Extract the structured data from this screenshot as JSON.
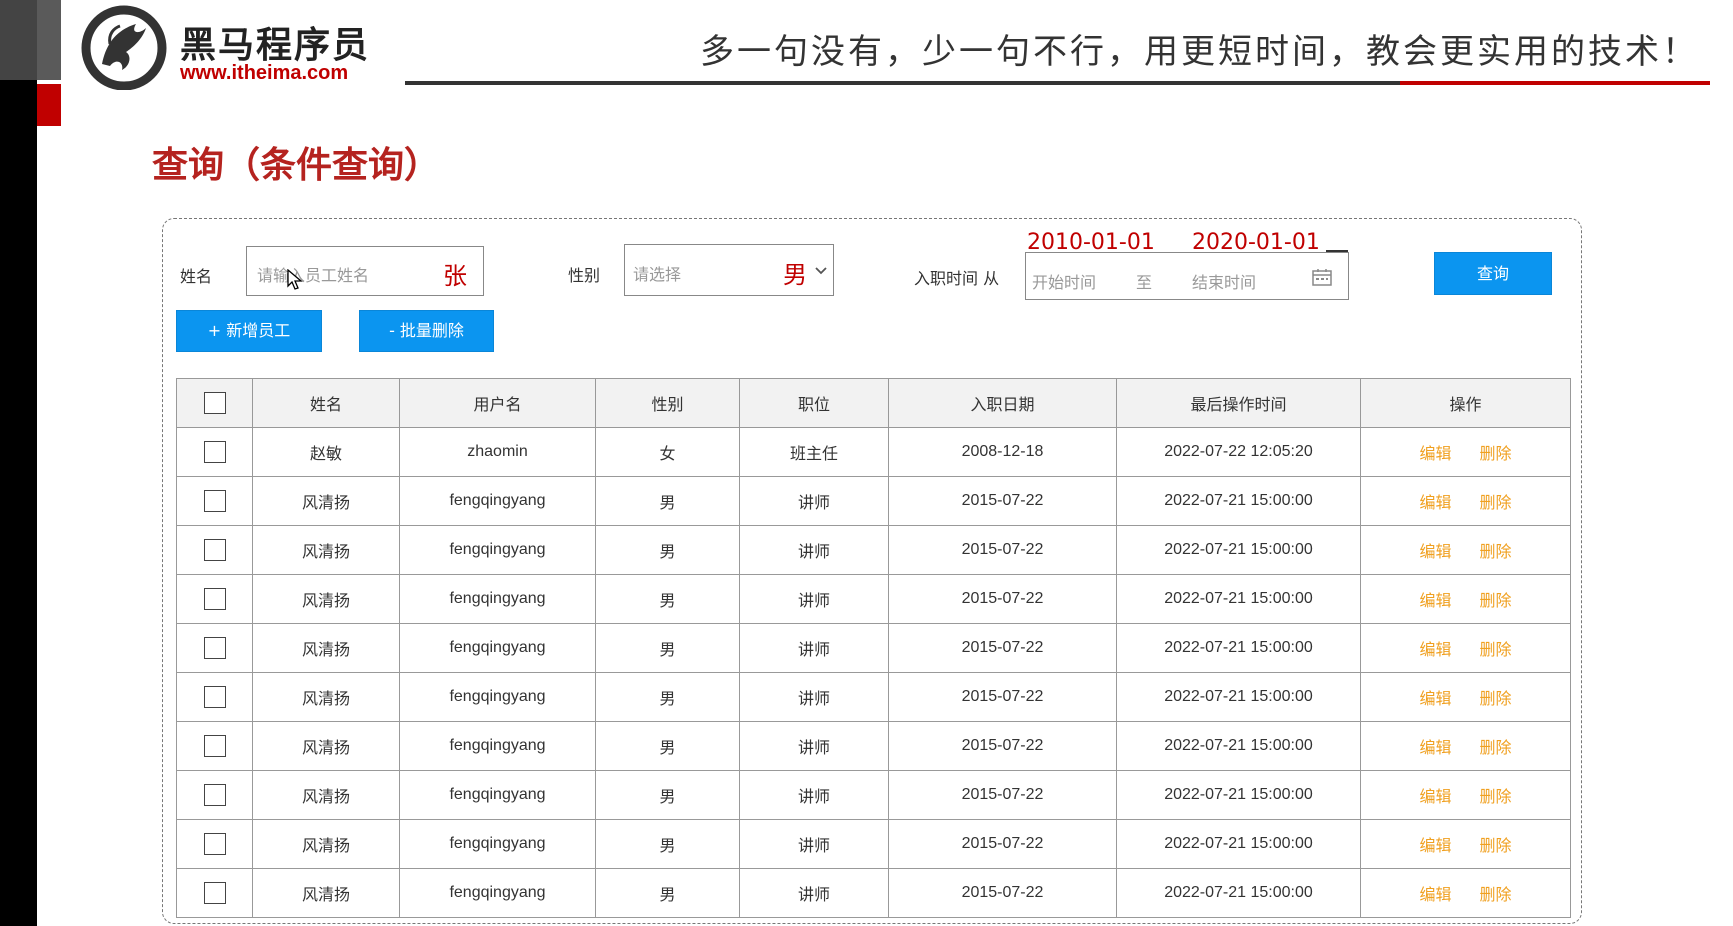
{
  "header": {
    "brand_name": "黑马程序员",
    "brand_url": "www.itheima.com",
    "slogan": "多一句没有，少一句不行，用更短时间，教会更实用的技术！"
  },
  "page_title": "查询（条件查询）",
  "filters": {
    "name_label": "姓名",
    "name_placeholder": "请输入员工姓名",
    "name_annotation": "张",
    "gender_label": "性别",
    "gender_placeholder": "请选择",
    "gender_annotation": "男",
    "date_label": "入职时间 从",
    "date_start_placeholder": "开始时间",
    "date_separator": "至",
    "date_end_placeholder": "结束时间",
    "date_start_annotation": "2010-01-01",
    "date_end_annotation": "2020-01-01",
    "query_button": "查询"
  },
  "toolbar": {
    "add_button": "+ 新增员工",
    "batch_delete_button": "- 批量删除"
  },
  "table": {
    "columns": [
      "姓名",
      "用户名",
      "性别",
      "职位",
      "入职日期",
      "最后操作时间",
      "操作"
    ],
    "actions": [
      "编辑",
      "删除"
    ],
    "rows": [
      [
        "赵敏",
        "zhaomin",
        "女",
        "班主任",
        "2008-12-18",
        "2022-07-22 12:05:20"
      ],
      [
        "风清扬",
        "fengqingyang",
        "男",
        "讲师",
        "2015-07-22",
        "2022-07-21 15:00:00"
      ],
      [
        "风清扬",
        "fengqingyang",
        "男",
        "讲师",
        "2015-07-22",
        "2022-07-21 15:00:00"
      ],
      [
        "风清扬",
        "fengqingyang",
        "男",
        "讲师",
        "2015-07-22",
        "2022-07-21 15:00:00"
      ],
      [
        "风清扬",
        "fengqingyang",
        "男",
        "讲师",
        "2015-07-22",
        "2022-07-21 15:00:00"
      ],
      [
        "风清扬",
        "fengqingyang",
        "男",
        "讲师",
        "2015-07-22",
        "2022-07-21 15:00:00"
      ],
      [
        "风清扬",
        "fengqingyang",
        "男",
        "讲师",
        "2015-07-22",
        "2022-07-21 15:00:00"
      ],
      [
        "风清扬",
        "fengqingyang",
        "男",
        "讲师",
        "2015-07-22",
        "2022-07-21 15:00:00"
      ],
      [
        "风清扬",
        "fengqingyang",
        "男",
        "讲师",
        "2015-07-22",
        "2022-07-21 15:00:00"
      ],
      [
        "风清扬",
        "fengqingyang",
        "男",
        "讲师",
        "2015-07-22",
        "2022-07-21 15:00:00"
      ]
    ]
  },
  "icons": {
    "logo": "horse-head-logo",
    "calendar": "calendar-icon",
    "dropdown": "chevron-down-icon",
    "cursor": "mouse-cursor-icon"
  },
  "colors": {
    "accent_blue": "#0b95f0",
    "title_red": "#b5231f",
    "action_orange": "#f0a020"
  }
}
